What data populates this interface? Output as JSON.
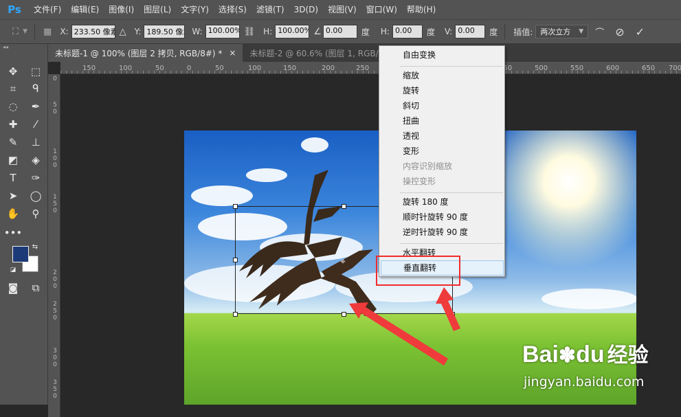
{
  "app": {
    "logo": "Ps"
  },
  "menubar": {
    "items": [
      "文件(F)",
      "编辑(E)",
      "图像(I)",
      "图层(L)",
      "文字(Y)",
      "选择(S)",
      "滤镜(T)",
      "3D(D)",
      "视图(V)",
      "窗口(W)",
      "帮助(H)"
    ]
  },
  "options": {
    "x_label": "X:",
    "x_value": "233.50 像素",
    "y_label": "Y:",
    "y_value": "189.50 像素",
    "w_label": "W:",
    "w_value": "100.00%",
    "h_label": "H:",
    "h_value": "100.00%",
    "angle_value": "0.00",
    "angle_unit": "度",
    "hskew_label": "H:",
    "hskew_value": "0.00",
    "hskew_unit": "度",
    "vskew_label": "V:",
    "vskew_value": "0.00",
    "vskew_unit": "度",
    "interp_label": "插值:",
    "interp_value": "两次立方"
  },
  "tabs": [
    {
      "label": "未标题-1 @ 100% (图层 2 拷贝, RGB/8#) *",
      "close": "×"
    },
    {
      "label": "未标题-2 @ 60.6% (图层 1, RGB/8#) *",
      "close": "×"
    }
  ],
  "ruler_h": [
    "150",
    "100",
    "50",
    "0",
    "50",
    "100",
    "150",
    "200",
    "250",
    "300",
    "350",
    "400",
    "450",
    "500",
    "550",
    "600",
    "650",
    "700"
  ],
  "ruler_v": [
    "0",
    "5 0",
    "1 0 0",
    "1 5 0",
    "2 0 0",
    "2 5 0",
    "3 0 0",
    "3 5 0"
  ],
  "context_menu": {
    "items": [
      {
        "label": "自由变换",
        "state": "normal"
      },
      {
        "label": "缩放",
        "state": "normal"
      },
      {
        "label": "旋转",
        "state": "normal"
      },
      {
        "label": "斜切",
        "state": "normal"
      },
      {
        "label": "扭曲",
        "state": "normal"
      },
      {
        "label": "透视",
        "state": "normal"
      },
      {
        "label": "变形",
        "state": "normal"
      },
      {
        "label": "内容识别缩放",
        "state": "disabled"
      },
      {
        "label": "操控变形",
        "state": "disabled"
      },
      {
        "label": "旋转 180 度",
        "state": "normal"
      },
      {
        "label": "顺时针旋转 90 度",
        "state": "normal"
      },
      {
        "label": "逆时针旋转 90 度",
        "state": "normal"
      },
      {
        "label": "水平翻转",
        "state": "normal"
      },
      {
        "label": "垂直翻转",
        "state": "hover"
      }
    ]
  },
  "colors": {
    "foreground": "#1d3a78",
    "background": "#ffffff",
    "annotation": "#f22b2b",
    "menu_hover": "#e5f1fb"
  },
  "watermark": {
    "brand": "Bai",
    "brand_tail": "du",
    "site_cn": "经验",
    "url": "jingyan.baidu.com"
  }
}
